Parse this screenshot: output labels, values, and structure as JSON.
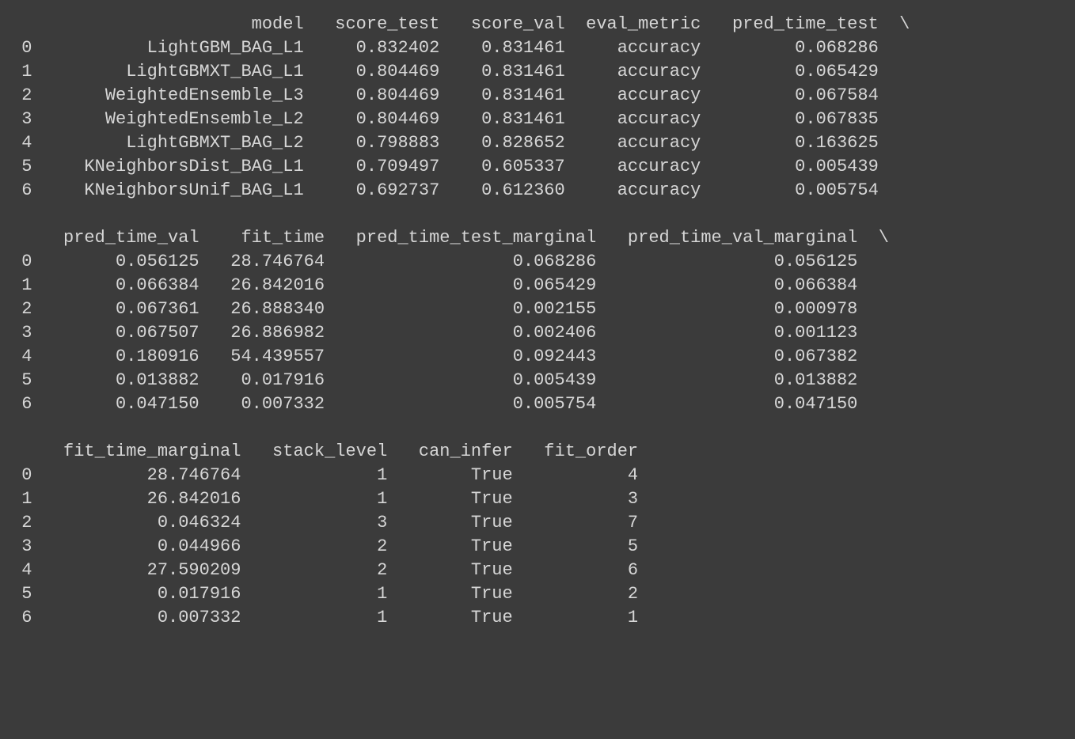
{
  "table": {
    "index": [
      "0",
      "1",
      "2",
      "3",
      "4",
      "5",
      "6"
    ],
    "columns": [
      "model",
      "score_test",
      "score_val",
      "eval_metric",
      "pred_time_test",
      "pred_time_val",
      "fit_time",
      "pred_time_test_marginal",
      "pred_time_val_marginal",
      "fit_time_marginal",
      "stack_level",
      "can_infer",
      "fit_order"
    ],
    "rows": [
      {
        "model": "LightGBM_BAG_L1",
        "score_test": "0.832402",
        "score_val": "0.831461",
        "eval_metric": "accuracy",
        "pred_time_test": "0.068286",
        "pred_time_val": "0.056125",
        "fit_time": "28.746764",
        "pred_time_test_marginal": "0.068286",
        "pred_time_val_marginal": "0.056125",
        "fit_time_marginal": "28.746764",
        "stack_level": "1",
        "can_infer": "True",
        "fit_order": "4"
      },
      {
        "model": "LightGBMXT_BAG_L1",
        "score_test": "0.804469",
        "score_val": "0.831461",
        "eval_metric": "accuracy",
        "pred_time_test": "0.065429",
        "pred_time_val": "0.066384",
        "fit_time": "26.842016",
        "pred_time_test_marginal": "0.065429",
        "pred_time_val_marginal": "0.066384",
        "fit_time_marginal": "26.842016",
        "stack_level": "1",
        "can_infer": "True",
        "fit_order": "3"
      },
      {
        "model": "WeightedEnsemble_L3",
        "score_test": "0.804469",
        "score_val": "0.831461",
        "eval_metric": "accuracy",
        "pred_time_test": "0.067584",
        "pred_time_val": "0.067361",
        "fit_time": "26.888340",
        "pred_time_test_marginal": "0.002155",
        "pred_time_val_marginal": "0.000978",
        "fit_time_marginal": "0.046324",
        "stack_level": "3",
        "can_infer": "True",
        "fit_order": "7"
      },
      {
        "model": "WeightedEnsemble_L2",
        "score_test": "0.804469",
        "score_val": "0.831461",
        "eval_metric": "accuracy",
        "pred_time_test": "0.067835",
        "pred_time_val": "0.067507",
        "fit_time": "26.886982",
        "pred_time_test_marginal": "0.002406",
        "pred_time_val_marginal": "0.001123",
        "fit_time_marginal": "0.044966",
        "stack_level": "2",
        "can_infer": "True",
        "fit_order": "5"
      },
      {
        "model": "LightGBMXT_BAG_L2",
        "score_test": "0.798883",
        "score_val": "0.828652",
        "eval_metric": "accuracy",
        "pred_time_test": "0.163625",
        "pred_time_val": "0.180916",
        "fit_time": "54.439557",
        "pred_time_test_marginal": "0.092443",
        "pred_time_val_marginal": "0.067382",
        "fit_time_marginal": "27.590209",
        "stack_level": "2",
        "can_infer": "True",
        "fit_order": "6"
      },
      {
        "model": "KNeighborsDist_BAG_L1",
        "score_test": "0.709497",
        "score_val": "0.605337",
        "eval_metric": "accuracy",
        "pred_time_test": "0.005439",
        "pred_time_val": "0.013882",
        "fit_time": "0.017916",
        "pred_time_test_marginal": "0.005439",
        "pred_time_val_marginal": "0.013882",
        "fit_time_marginal": "0.017916",
        "stack_level": "1",
        "can_infer": "True",
        "fit_order": "2"
      },
      {
        "model": "KNeighborsUnif_BAG_L1",
        "score_test": "0.692737",
        "score_val": "0.612360",
        "eval_metric": "accuracy",
        "pred_time_test": "0.005754",
        "pred_time_val": "0.047150",
        "fit_time": "0.007332",
        "pred_time_test_marginal": "0.005754",
        "pred_time_val_marginal": "0.047150",
        "fit_time_marginal": "0.007332",
        "stack_level": "1",
        "can_infer": "True",
        "fit_order": "1"
      }
    ],
    "blocks": [
      {
        "columns": [
          "model",
          "score_test",
          "score_val",
          "eval_metric",
          "pred_time_test"
        ],
        "widths": {
          "index": 2,
          "model": 25,
          "score_test": 12,
          "score_val": 11,
          "eval_metric": 12,
          "pred_time_test": 16
        },
        "continuation": true
      },
      {
        "columns": [
          "pred_time_val",
          "fit_time",
          "pred_time_test_marginal",
          "pred_time_val_marginal"
        ],
        "widths": {
          "index": 2,
          "pred_time_val": 15,
          "fit_time": 11,
          "pred_time_test_marginal": 25,
          "pred_time_val_marginal": 24
        },
        "continuation": true
      },
      {
        "columns": [
          "fit_time_marginal",
          "stack_level",
          "can_infer",
          "fit_order"
        ],
        "widths": {
          "index": 2,
          "fit_time_marginal": 19,
          "stack_level": 13,
          "can_infer": 11,
          "fit_order": 11
        },
        "continuation": false
      }
    ],
    "continuation_glyph": "\\"
  }
}
